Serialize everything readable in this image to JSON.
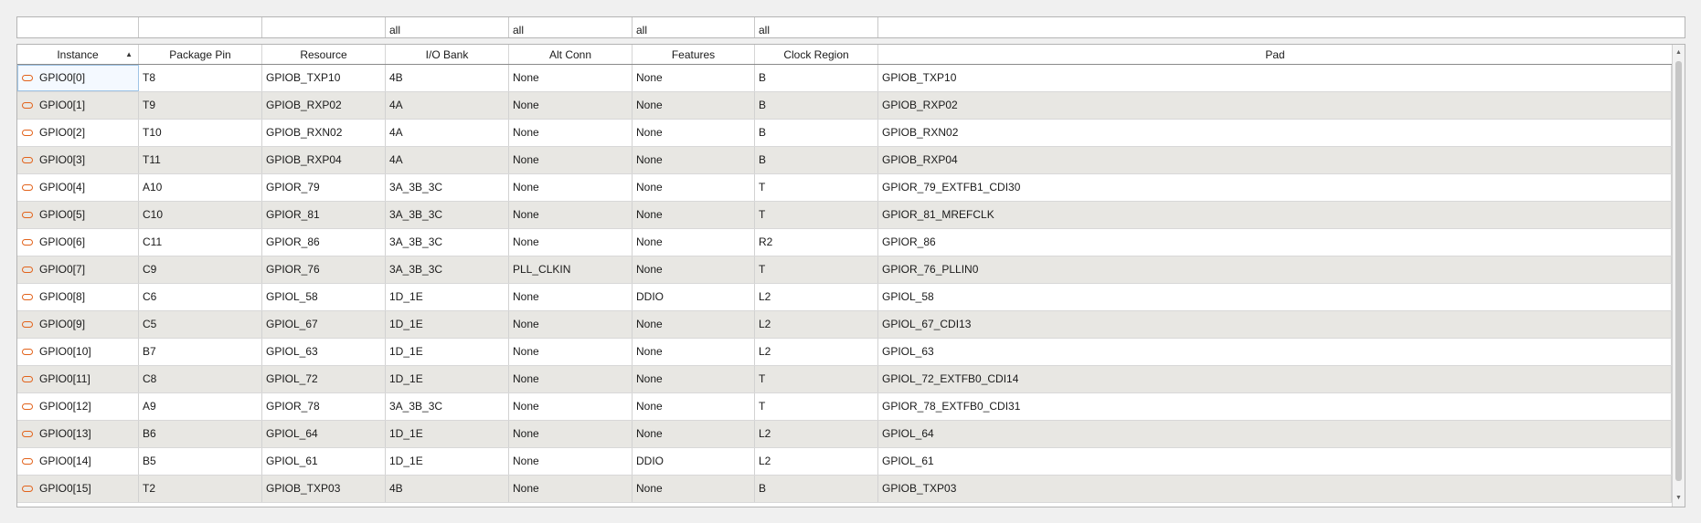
{
  "filters": [
    "",
    "",
    "",
    "all",
    "all",
    "all",
    "all",
    ""
  ],
  "columns": [
    {
      "label": "Instance",
      "sorted": "ascending"
    },
    {
      "label": "Package Pin"
    },
    {
      "label": "Resource"
    },
    {
      "label": "I/O Bank"
    },
    {
      "label": "Alt Conn"
    },
    {
      "label": "Features"
    },
    {
      "label": "Clock Region"
    },
    {
      "label": "Pad"
    }
  ],
  "sort_icon": "▲",
  "scroll_up_icon": "▲",
  "scroll_down_icon": "▼",
  "accent_color": "#e2621a",
  "rows": [
    {
      "instance": "GPIO0[0]",
      "pin": "T8",
      "resource": "GPIOB_TXP10",
      "bank": "4B",
      "alt": "None",
      "features": "None",
      "clock": "B",
      "pad": "GPIOB_TXP10"
    },
    {
      "instance": "GPIO0[1]",
      "pin": "T9",
      "resource": "GPIOB_RXP02",
      "bank": "4A",
      "alt": "None",
      "features": "None",
      "clock": "B",
      "pad": "GPIOB_RXP02"
    },
    {
      "instance": "GPIO0[2]",
      "pin": "T10",
      "resource": "GPIOB_RXN02",
      "bank": "4A",
      "alt": "None",
      "features": "None",
      "clock": "B",
      "pad": "GPIOB_RXN02"
    },
    {
      "instance": "GPIO0[3]",
      "pin": "T11",
      "resource": "GPIOB_RXP04",
      "bank": "4A",
      "alt": "None",
      "features": "None",
      "clock": "B",
      "pad": "GPIOB_RXP04"
    },
    {
      "instance": "GPIO0[4]",
      "pin": "A10",
      "resource": "GPIOR_79",
      "bank": "3A_3B_3C",
      "alt": "None",
      "features": "None",
      "clock": "T",
      "pad": "GPIOR_79_EXTFB1_CDI30"
    },
    {
      "instance": "GPIO0[5]",
      "pin": "C10",
      "resource": "GPIOR_81",
      "bank": "3A_3B_3C",
      "alt": "None",
      "features": "None",
      "clock": "T",
      "pad": "GPIOR_81_MREFCLK"
    },
    {
      "instance": "GPIO0[6]",
      "pin": "C11",
      "resource": "GPIOR_86",
      "bank": "3A_3B_3C",
      "alt": "None",
      "features": "None",
      "clock": "R2",
      "pad": "GPIOR_86"
    },
    {
      "instance": "GPIO0[7]",
      "pin": "C9",
      "resource": "GPIOR_76",
      "bank": "3A_3B_3C",
      "alt": "PLL_CLKIN",
      "features": "None",
      "clock": "T",
      "pad": "GPIOR_76_PLLIN0"
    },
    {
      "instance": "GPIO0[8]",
      "pin": "C6",
      "resource": "GPIOL_58",
      "bank": "1D_1E",
      "alt": "None",
      "features": "DDIO",
      "clock": "L2",
      "pad": "GPIOL_58"
    },
    {
      "instance": "GPIO0[9]",
      "pin": "C5",
      "resource": "GPIOL_67",
      "bank": "1D_1E",
      "alt": "None",
      "features": "None",
      "clock": "L2",
      "pad": "GPIOL_67_CDI13"
    },
    {
      "instance": "GPIO0[10]",
      "pin": "B7",
      "resource": "GPIOL_63",
      "bank": "1D_1E",
      "alt": "None",
      "features": "None",
      "clock": "L2",
      "pad": "GPIOL_63"
    },
    {
      "instance": "GPIO0[11]",
      "pin": "C8",
      "resource": "GPIOL_72",
      "bank": "1D_1E",
      "alt": "None",
      "features": "None",
      "clock": "T",
      "pad": "GPIOL_72_EXTFB0_CDI14"
    },
    {
      "instance": "GPIO0[12]",
      "pin": "A9",
      "resource": "GPIOR_78",
      "bank": "3A_3B_3C",
      "alt": "None",
      "features": "None",
      "clock": "T",
      "pad": "GPIOR_78_EXTFB0_CDI31"
    },
    {
      "instance": "GPIO0[13]",
      "pin": "B6",
      "resource": "GPIOL_64",
      "bank": "1D_1E",
      "alt": "None",
      "features": "None",
      "clock": "L2",
      "pad": "GPIOL_64"
    },
    {
      "instance": "GPIO0[14]",
      "pin": "B5",
      "resource": "GPIOL_61",
      "bank": "1D_1E",
      "alt": "None",
      "features": "DDIO",
      "clock": "L2",
      "pad": "GPIOL_61"
    },
    {
      "instance": "GPIO0[15]",
      "pin": "T2",
      "resource": "GPIOB_TXP03",
      "bank": "4B",
      "alt": "None",
      "features": "None",
      "clock": "B",
      "pad": "GPIOB_TXP03"
    }
  ]
}
